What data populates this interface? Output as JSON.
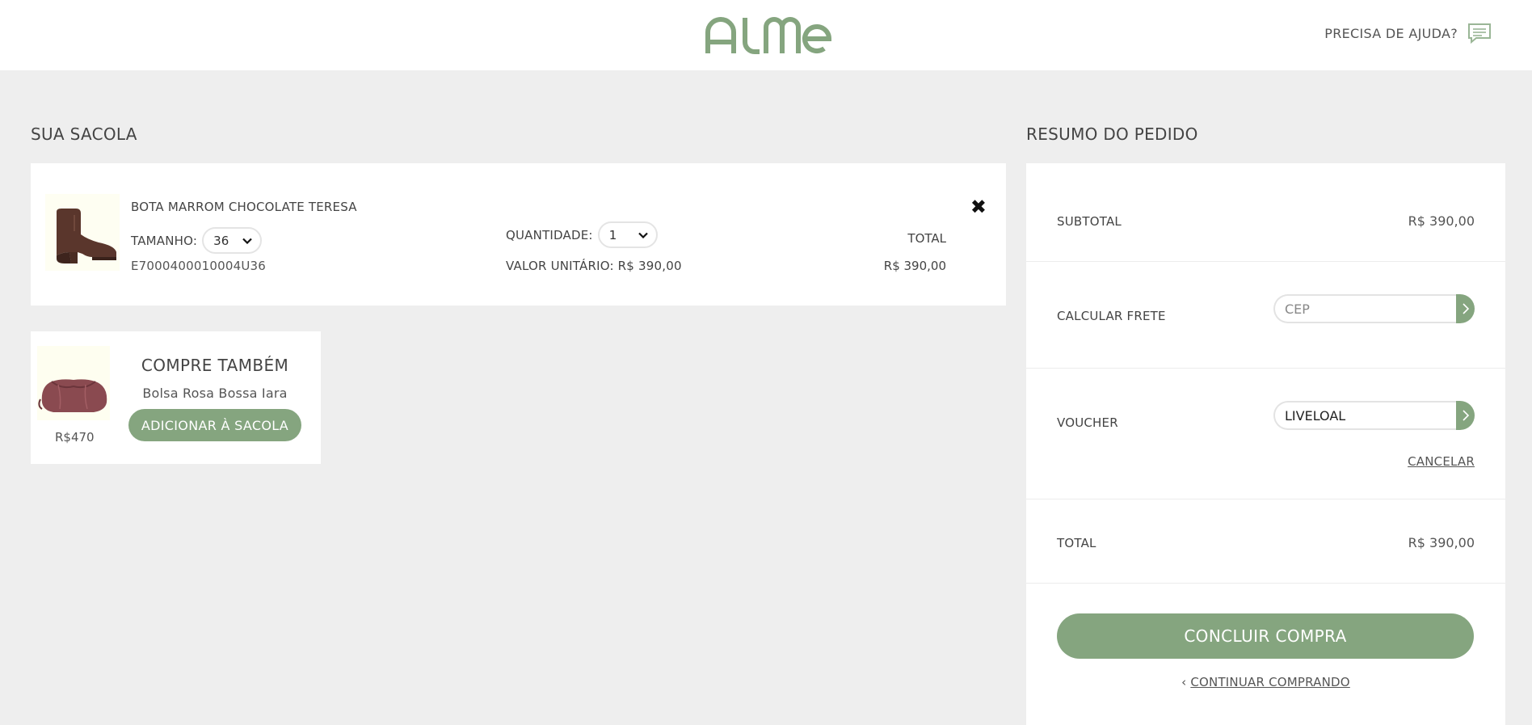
{
  "header": {
    "brand": "ALME",
    "help_label": "PRECISA DE AJUDA?",
    "help_icon": "chat-icon"
  },
  "colors": {
    "accent": "#85a57f",
    "page_bg": "#eeeeee",
    "card_bg": "#ffffff"
  },
  "cart": {
    "title": "SUA SACOLA",
    "item": {
      "name": "BOTA MARROM CHOCOLATE TERESA",
      "size_label": "TAMANHO:",
      "size_value": "36",
      "sku": "E7000400010004U36",
      "qty_label": "QUANTIDADE:",
      "qty_value": "1",
      "unit_price_label": "VALOR UNITÁRIO: R$ 390,00",
      "total_label": "TOTAL",
      "total_value": "R$ 390,00",
      "remove_icon": "close-icon",
      "image_icon": "boot-image"
    }
  },
  "upsell": {
    "title": "COMPRE TAMBÉM",
    "product_name": "Bolsa Rosa Bossa Iara",
    "price": "R$470",
    "button_label": "ADICIONAR À SACOLA",
    "image_icon": "handbag-image"
  },
  "summary": {
    "title": "RESUMO DO PEDIDO",
    "subtotal_label": "SUBTOTAL",
    "subtotal_value": "R$ 390,00",
    "shipping_label": "CALCULAR FRETE",
    "shipping_placeholder": "CEP",
    "voucher_label": "VOUCHER",
    "voucher_value": "LIVELOAL",
    "cancel_label": "CANCELAR",
    "total_label": "TOTAL",
    "total_value": "R$ 390,00",
    "conclude_label": "CONCLUIR COMPRA",
    "continue_label": "CONTINUAR COMPRANDO"
  }
}
